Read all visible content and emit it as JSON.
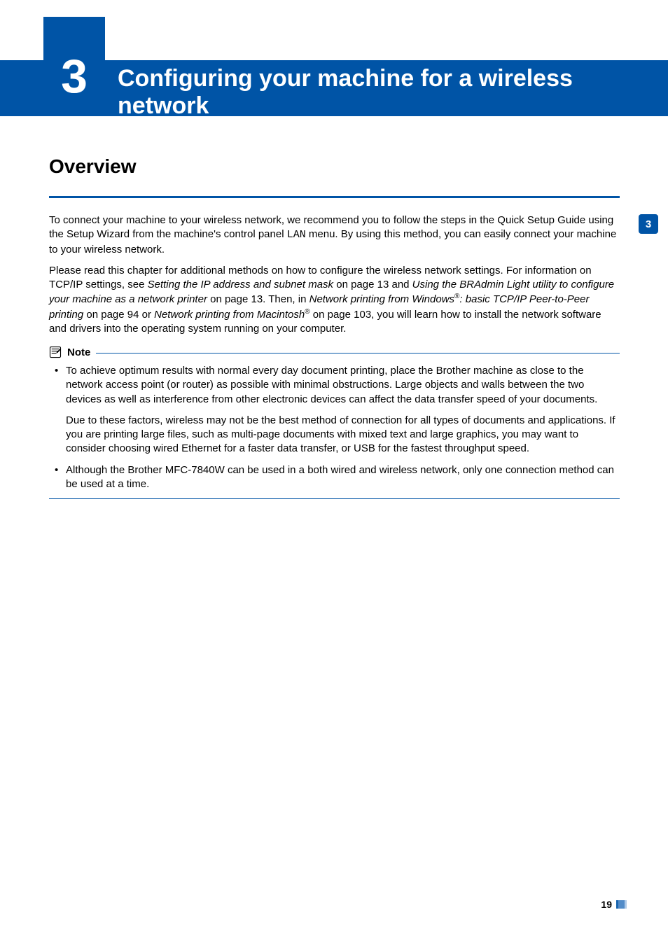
{
  "chapter": {
    "number": "3",
    "title": "Configuring your machine for a wireless network"
  },
  "side_tab": "3",
  "page_number": "19",
  "overview": {
    "heading": "Overview",
    "p1_a": "To connect your machine to your wireless network, we recommend you to follow the steps in the Quick Setup Guide using the Setup Wizard from the machine's control panel ",
    "p1_mono": "LAN",
    "p1_b": " menu. By using this method, you can easily connect your machine to your wireless network.",
    "p2_a": "Please read this chapter for additional methods on how to configure the wireless network settings. For information on TCP/IP settings, see ",
    "p2_i1": "Setting the IP address and subnet mask",
    "p2_b": " on page 13 and ",
    "p2_i2": "Using the BRAdmin Light utility to configure your machine as a network printer",
    "p2_c": " on page 13. Then, in ",
    "p2_i3": "Network printing from Windows",
    "p2_sup1": "®",
    "p2_i3b": ": basic TCP/IP Peer-to-Peer printing",
    "p2_d": " on page 94 or ",
    "p2_i4": "Network printing from Macintosh",
    "p2_sup2": "®",
    "p2_e": " on page 103, you will learn how to install the network software and drivers into the operating system running on your computer."
  },
  "note": {
    "label": "Note",
    "bullet1_a": "To achieve optimum results with normal every day document printing, place the Brother machine as close to the network access point (or router) as possible with minimal obstructions. Large objects and walls between the two devices as well as interference from other electronic devices can affect the data transfer speed of your documents.",
    "bullet1_b": "Due to these factors, wireless may not be the best method of connection for all types of documents and applications. If you are printing large files, such as multi-page documents with mixed text and large graphics, you may want to consider choosing wired Ethernet for a faster data transfer, or USB for the fastest throughput speed.",
    "bullet2": "Although the Brother MFC-7840W can be used in a both wired and wireless network, only one connection method can be used at a time."
  }
}
